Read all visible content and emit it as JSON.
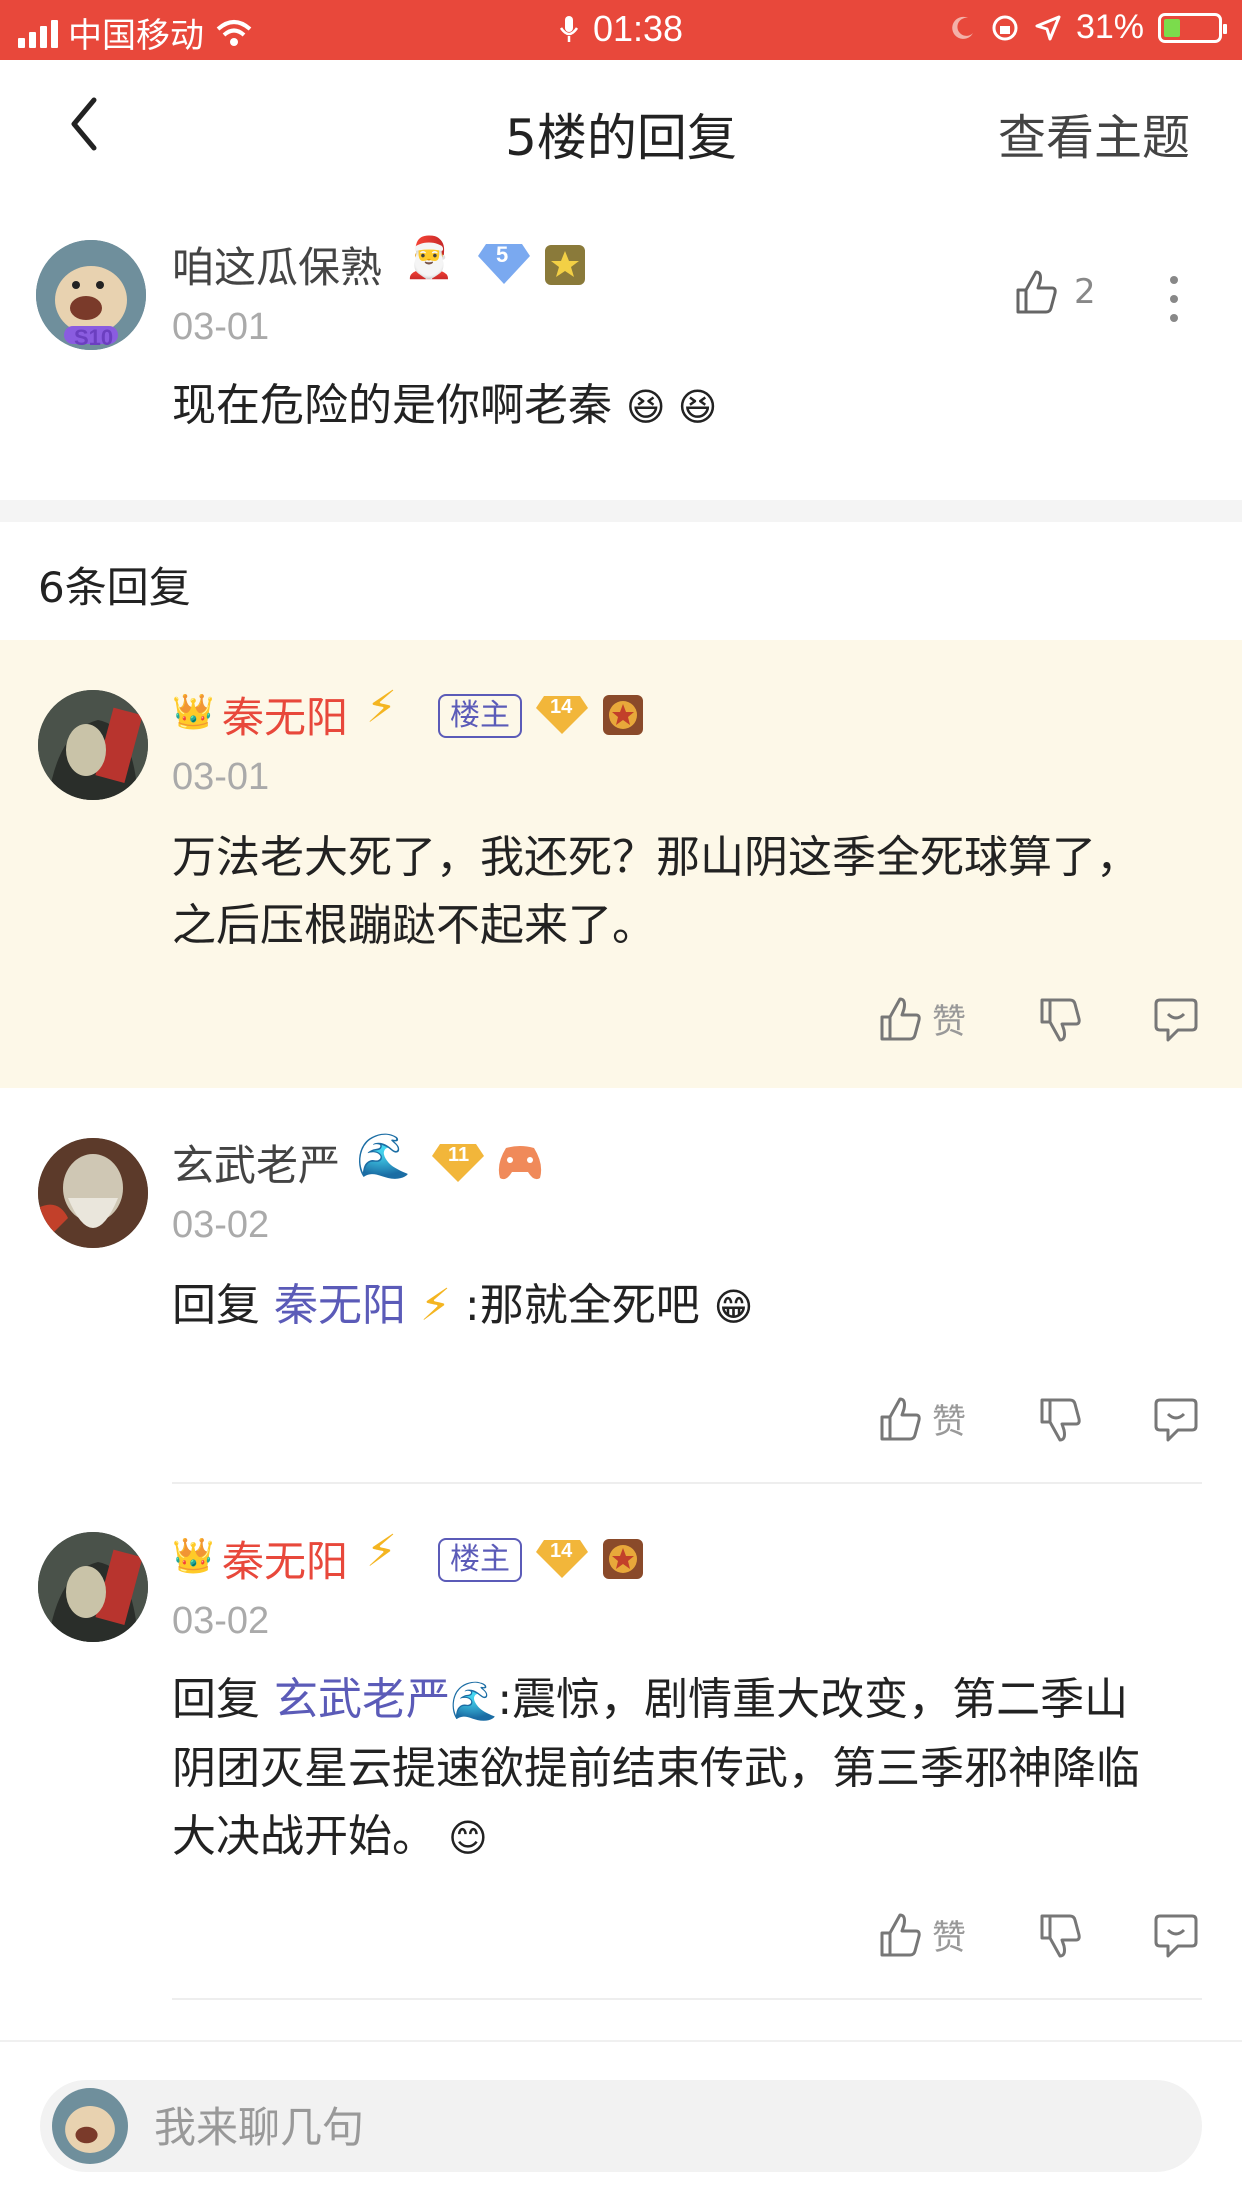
{
  "status_bar": {
    "carrier": "中国移动",
    "time": "01:38",
    "battery_percent": "31%",
    "battery_level": 0.31
  },
  "nav": {
    "back_icon": "chevron-left-icon",
    "title": "5楼的回复",
    "topic_link": "查看主题"
  },
  "main_post": {
    "username": "咱这瓜保熟",
    "level": "5",
    "avatar_badge": "S10",
    "date": "03-01",
    "text": "现在危险的是你啊老秦",
    "like_count": "2"
  },
  "replies_header": "6条回复",
  "replies": [
    {
      "username": "秦无阳",
      "owner_tag": "楼主",
      "level": "14",
      "date": "03-01",
      "line1": "万法老大死了，我还死？那山阴这季全死球算了，",
      "line2": "之后压根蹦跶不起来了。",
      "like_label": "赞"
    },
    {
      "username": "玄武老严",
      "level": "11",
      "date": "03-02",
      "reply_prefix": "回复 ",
      "reply_to": "秦无阳",
      "text": ":那就全死吧",
      "like_label": "赞"
    },
    {
      "username": "秦无阳",
      "owner_tag": "楼主",
      "level": "14",
      "date": "03-02",
      "reply_prefix": "回复 ",
      "reply_to": "玄武老严",
      "line1": ":震惊，剧情重大改变，第二季山",
      "line2": "阴团灭星云提速欲提前结束传武，第三季邪神降临",
      "line3": "大决战开始。",
      "like_label": "赞"
    }
  ],
  "bottom_bar": {
    "placeholder": "我来聊几句"
  },
  "colors": {
    "status_bar": "#e8483b",
    "highlight_bg": "#fdf8e8",
    "owner_name": "#e8483b",
    "link": "#5b5bb8"
  }
}
